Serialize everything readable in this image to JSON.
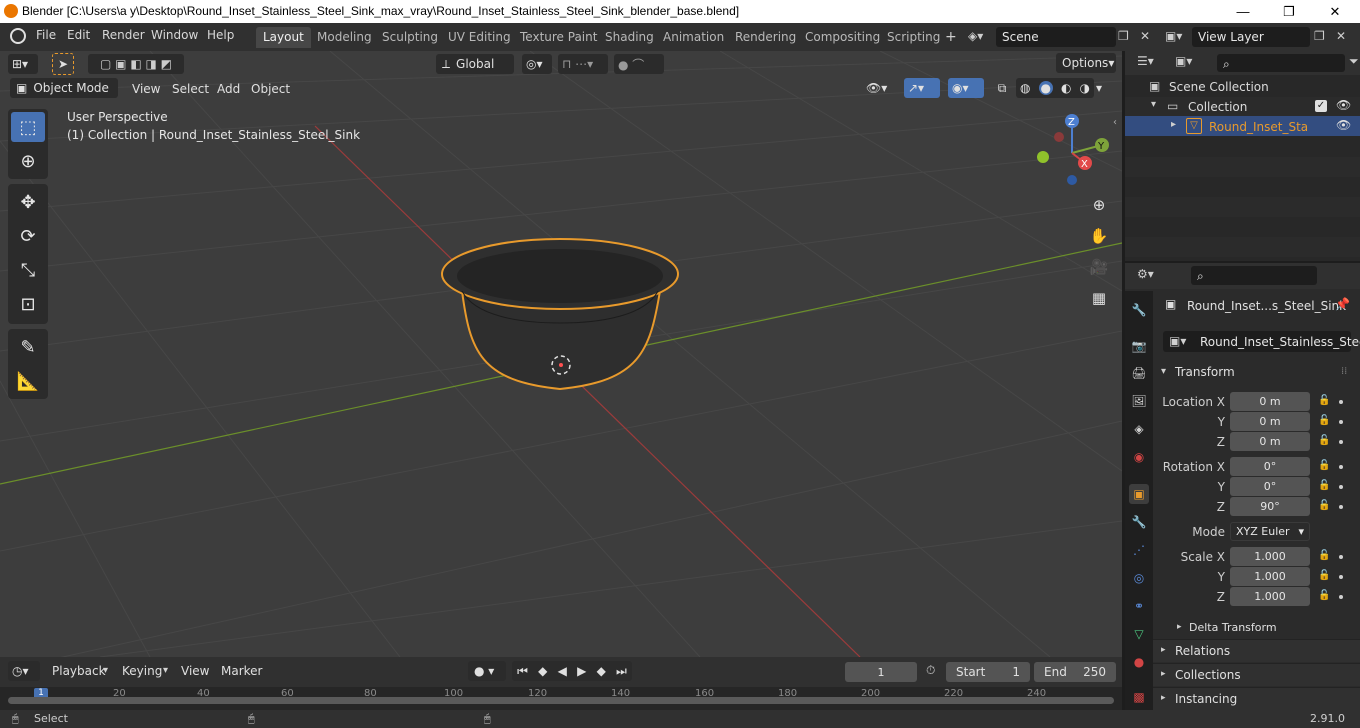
{
  "window": {
    "title": "Blender [C:\\Users\\a y\\Desktop\\Round_Inset_Stainless_Steel_Sink_max_vray\\Round_Inset_Stainless_Steel_Sink_blender_base.blend]",
    "minimize": "—",
    "maximize": "❐",
    "close": "✕"
  },
  "menu": [
    "File",
    "Edit",
    "Render",
    "Window",
    "Help"
  ],
  "workspaces": [
    "Layout",
    "Modeling",
    "Sculpting",
    "UV Editing",
    "Texture Paint",
    "Shading",
    "Animation",
    "Rendering",
    "Compositing",
    "Scripting"
  ],
  "active_workspace": "Layout",
  "scene": "Scene",
  "view_layer": "View Layer",
  "viewport": {
    "mode": "Object Mode",
    "menus": [
      "View",
      "Select",
      "Add",
      "Object"
    ],
    "orientation": "Global",
    "options": "Options",
    "perspective": "User Perspective",
    "collection_info": "(1) Collection | Round_Inset_Stainless_Steel_Sink",
    "gizmo": {
      "z": "Z",
      "y": "Y",
      "x": "X"
    }
  },
  "outliner": {
    "scene_collection": "Scene Collection",
    "collection": "Collection",
    "object": "Round_Inset_Stainles"
  },
  "properties": {
    "object_name": "Round_Inset...s_Steel_Sink",
    "object_field": "Round_Inset_Stainless_Steel...",
    "transform": "Transform",
    "location_label": "Location X",
    "y_label": "Y",
    "z_label": "Z",
    "location": [
      "0 m",
      "0 m",
      "0 m"
    ],
    "rotation_label": "Rotation X",
    "rotation": [
      "0°",
      "0°",
      "90°"
    ],
    "mode_label": "Mode",
    "mode": "XYZ Euler",
    "scale_label": "Scale X",
    "scale": [
      "1.000",
      "1.000",
      "1.000"
    ],
    "delta": "Delta Transform",
    "relations": "Relations",
    "collections": "Collections",
    "instancing": "Instancing"
  },
  "timeline": {
    "menus": [
      "Playback",
      "Keying",
      "View",
      "Marker"
    ],
    "current_frame": "1",
    "start_label": "Start",
    "start": "1",
    "end_label": "End",
    "end": "250",
    "ruler": [
      "1",
      "20",
      "40",
      "60",
      "80",
      "100",
      "120",
      "140",
      "160",
      "180",
      "200",
      "220",
      "240"
    ]
  },
  "status": {
    "select": "Select",
    "version": "2.91.0"
  }
}
